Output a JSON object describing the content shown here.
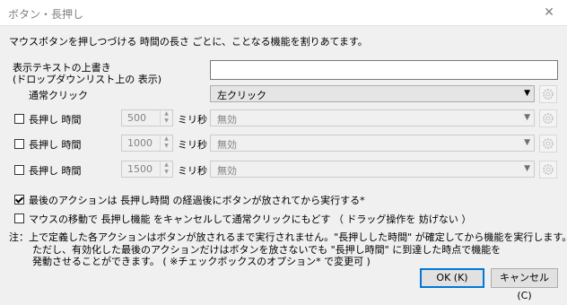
{
  "window": {
    "title": "ボタン・長押し",
    "close": "✕"
  },
  "description": "マウスボタンを押しつづける 時間の長さ ごとに、ことなる機能を割りあてます。",
  "override": {
    "label_line1": "表示テキストの上書き",
    "label_line2": "(ドロップダウンリスト上の 表示)",
    "value": ""
  },
  "normal_click": {
    "label": "通常クリック",
    "selected": "左クリック"
  },
  "hold_rows": [
    {
      "label": "長押し 時間",
      "value": "500",
      "unit": "ミリ秒",
      "selected": "無効",
      "checked": false
    },
    {
      "label": "長押し 時間",
      "value": "1000",
      "unit": "ミリ秒",
      "selected": "無効",
      "checked": false
    },
    {
      "label": "長押し 時間",
      "value": "1500",
      "unit": "ミリ秒",
      "selected": "無効",
      "checked": false
    }
  ],
  "options": {
    "last_action": {
      "label": "最後のアクションは 長押し時間 の経過後にボタンが放されてから実行する*",
      "checked": true
    },
    "mouse_move": {
      "label": "マウスの移動で 長押し機能 をキャンセルして通常クリックにもどす （ ドラッグ操作を 妨げない ）",
      "checked": false
    }
  },
  "note": {
    "line1": "注：上で定義した各アクションはボタンが放されるまで実行されません。\"長押しした時間\" が確定してから機能を実行します。",
    "line2": "ただし、有効化した最後のアクションだけはボタンを放さないでも \"長押し時間\" に到達した時点で機能を",
    "line3": "発動させることができます。 ( ※チェックボックスのオプション* で変更可 )"
  },
  "buttons": {
    "ok": "OK (K)",
    "cancel": "キャンセル (C)"
  },
  "icons": {
    "gear": "gear-icon",
    "dropdown": "chevron-down-icon",
    "spin": "spin-up-down-icon"
  }
}
